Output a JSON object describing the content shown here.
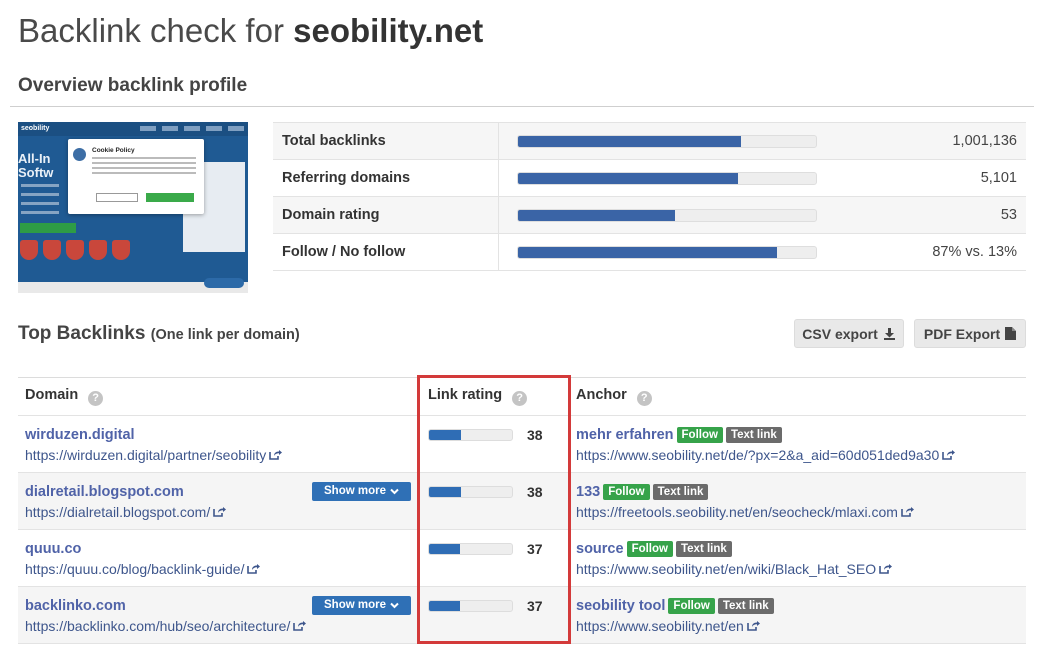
{
  "title": {
    "prefix": "Backlink check for ",
    "domain": "seobility.net"
  },
  "overview": {
    "heading": "Overview backlink profile",
    "preview": {
      "logo": "seobility",
      "hero": "All-In\nSoftw",
      "cookie_title": "Cookie Policy"
    },
    "stats": [
      {
        "label": "Total backlinks",
        "fill": 0.75,
        "value": "1,001,136"
      },
      {
        "label": "Referring domains",
        "fill": 0.74,
        "value": "5,101"
      },
      {
        "label": "Domain rating",
        "fill": 0.53,
        "value": "53"
      },
      {
        "label": "Follow / No follow",
        "fill": 0.87,
        "value": "87% vs. 13%"
      }
    ]
  },
  "top_backlinks": {
    "heading": "Top Backlinks",
    "subheading": "(One link per domain)",
    "csv_label": "CSV export",
    "pdf_label": "PDF Export",
    "columns": {
      "domain": "Domain",
      "rating": "Link rating",
      "anchor": "Anchor"
    },
    "show_more_label": "Show more",
    "rows": [
      {
        "domain": "wirduzen.digital",
        "url": "https://wirduzen.digital/partner/seobility",
        "rating": "38",
        "fill": 0.38,
        "anchor": "mehr erfahren",
        "follow": "Follow",
        "type": "Text link",
        "anchor_url": "https://www.seobility.net/de/?px=2&a_aid=60d051ded9a30",
        "show_more": false
      },
      {
        "domain": "dialretail.blogspot.com",
        "url": "https://dialretail.blogspot.com/",
        "rating": "38",
        "fill": 0.38,
        "anchor": "133",
        "follow": "Follow",
        "type": "Text link",
        "anchor_url": "https://freetools.seobility.net/en/seocheck/mlaxi.com",
        "show_more": true
      },
      {
        "domain": "quuu.co",
        "url": "https://quuu.co/blog/backlink-guide/",
        "rating": "37",
        "fill": 0.37,
        "anchor": "source",
        "follow": "Follow",
        "type": "Text link",
        "anchor_url": "https://www.seobility.net/en/wiki/Black_Hat_SEO",
        "show_more": false
      },
      {
        "domain": "backlinko.com",
        "url": "https://backlinko.com/hub/seo/architecture/",
        "rating": "37",
        "fill": 0.37,
        "anchor": "seobility tool",
        "follow": "Follow",
        "type": "Text link",
        "anchor_url": "https://www.seobility.net/en",
        "show_more": true
      }
    ]
  },
  "colors": {
    "bar": "#3a64a6",
    "rating_bar": "#2f6db5",
    "follow": "#36a34a",
    "text_link": "#6b6b6b",
    "highlight": "#d33a3a",
    "link": "#5063a8"
  }
}
